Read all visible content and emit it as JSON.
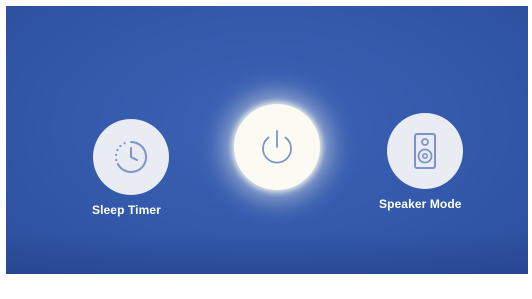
{
  "buttons": {
    "sleep_timer": {
      "label": "Sleep Timer",
      "icon": "sleep-timer-icon"
    },
    "power": {
      "icon": "power-icon"
    },
    "speaker_mode": {
      "label": "Speaker Mode",
      "icon": "speaker-icon"
    }
  },
  "colors": {
    "background": "#3459ab",
    "button_fill": "#e9ecf3",
    "power_fill": "#fbfbf4",
    "icon_stroke": "#7e93c6",
    "label_text": "#ffffff"
  }
}
